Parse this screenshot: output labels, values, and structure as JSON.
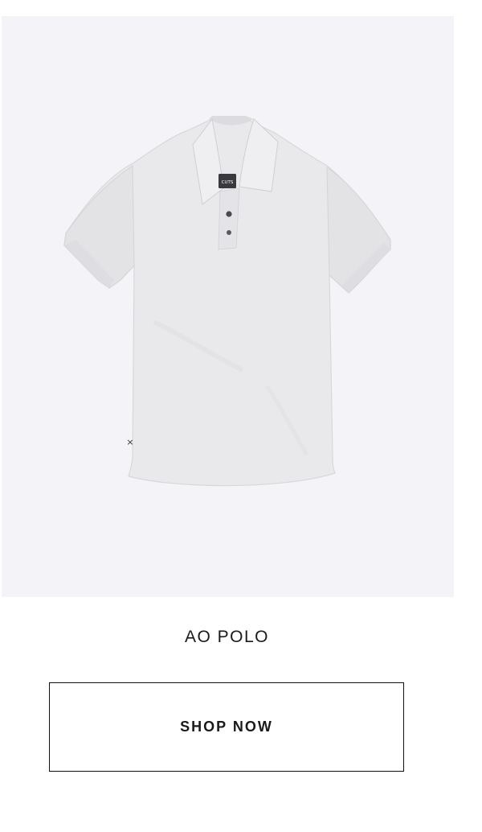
{
  "product": {
    "image_alt": "AO Polo shirt in light grey",
    "brand_tag": "CUTS",
    "title": "AO POLO"
  },
  "cta": {
    "label": "SHOP NOW"
  },
  "colors": {
    "image_background": "#f4f4f8",
    "shirt": "#e9e9eb",
    "text": "#1a1a1a",
    "button_border": "#111111"
  }
}
